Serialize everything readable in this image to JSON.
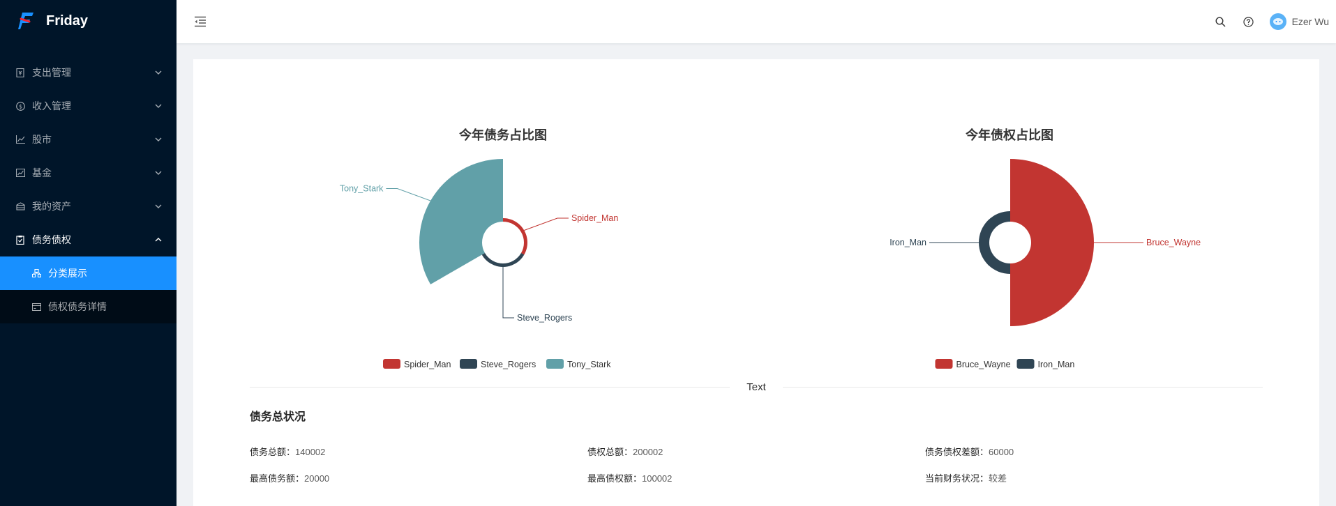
{
  "app": {
    "name": "Friday"
  },
  "sidebar": {
    "items": [
      {
        "label": "支出管理",
        "icon": "receipt-icon"
      },
      {
        "label": "收入管理",
        "icon": "dollar-circle-icon"
      },
      {
        "label": "股市",
        "icon": "line-chart-icon"
      },
      {
        "label": "基金",
        "icon": "fund-icon"
      },
      {
        "label": "我的资产",
        "icon": "bank-icon"
      },
      {
        "label": "债务债权",
        "icon": "audit-icon"
      }
    ],
    "submenu": [
      {
        "label": "分类展示",
        "icon": "cluster-icon",
        "active": true
      },
      {
        "label": "债权债务详情",
        "icon": "credit-card-icon",
        "active": false
      }
    ]
  },
  "header": {
    "user_name": "Ezer Wu"
  },
  "charts": {
    "left": {
      "title": "今年债务占比图"
    },
    "right": {
      "title": "今年债权占比图"
    }
  },
  "chart_data": [
    {
      "type": "pie",
      "variant": "rose",
      "title": "今年债务占比图",
      "slices": [
        {
          "name": "Spider_Man",
          "value": 20000,
          "color": "#c23531"
        },
        {
          "name": "Steve_Rogers",
          "value": 20000,
          "color": "#2f4554"
        },
        {
          "name": "Tony_Stark",
          "value": 100002,
          "color": "#61a0a8"
        }
      ],
      "legend_position": "bottom"
    },
    {
      "type": "pie",
      "variant": "rose",
      "title": "今年债权占比图",
      "slices": [
        {
          "name": "Bruce_Wayne",
          "value": 100002,
          "color": "#c23531"
        },
        {
          "name": "Iron_Man",
          "value": 100000,
          "color": "#2f4554"
        }
      ],
      "legend_position": "bottom"
    }
  ],
  "divider": {
    "text": "Text"
  },
  "summary": {
    "title": "债务总状况",
    "rows": [
      [
        {
          "key": "债务总额：",
          "value": "140002"
        },
        {
          "key": "债权总额：",
          "value": "200002"
        },
        {
          "key": "债务债权差额：",
          "value": "60000"
        }
      ],
      [
        {
          "key": "最高债务额：",
          "value": "20000"
        },
        {
          "key": "最高债权额：",
          "value": "100002"
        },
        {
          "key": "当前财务状况：",
          "value": "较差"
        }
      ]
    ]
  }
}
